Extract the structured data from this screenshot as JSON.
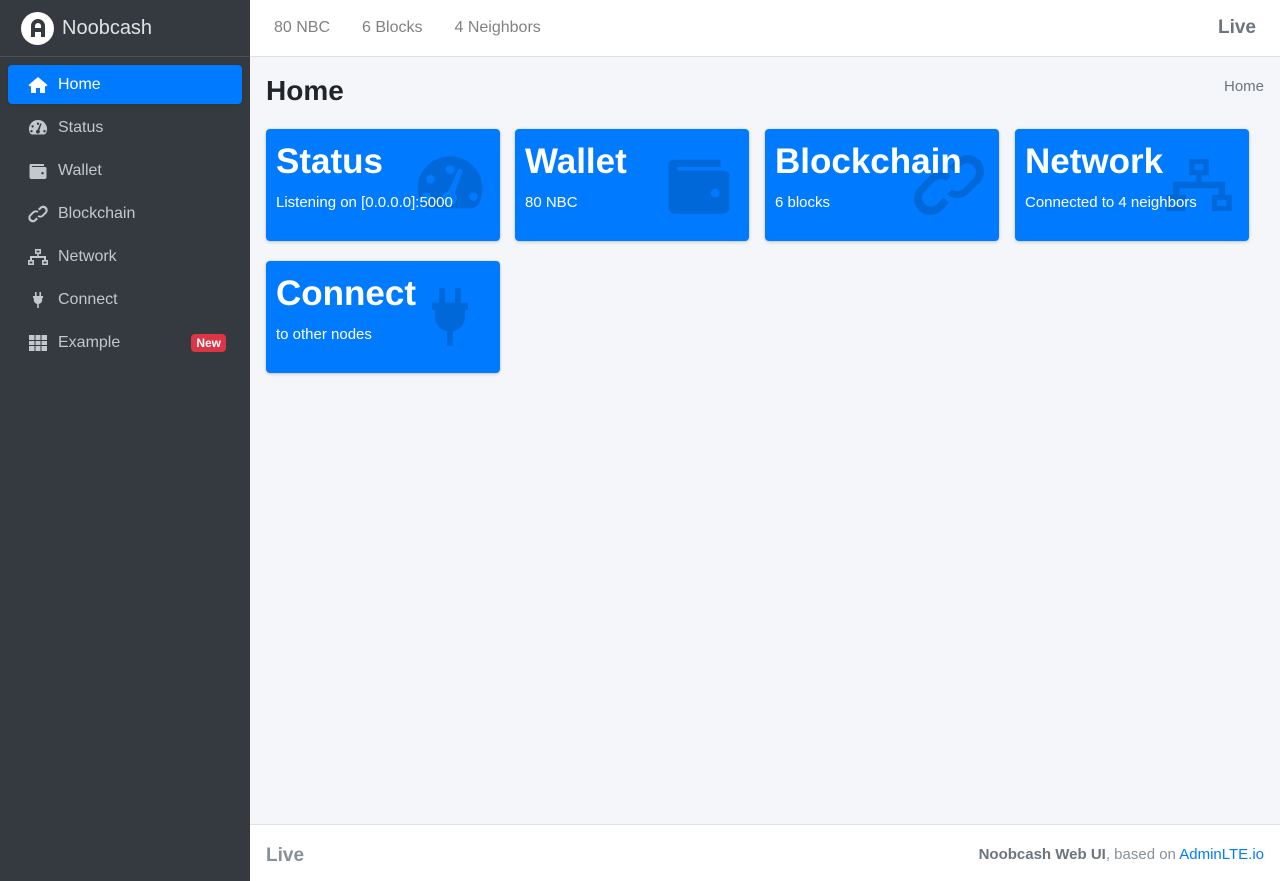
{
  "brand": {
    "name": "Noobcash",
    "logo_icon": "letter-a-circle-logo"
  },
  "sidebar": {
    "items": [
      {
        "label": "Home",
        "icon": "home-icon",
        "active": true
      },
      {
        "label": "Status",
        "icon": "gauge-icon"
      },
      {
        "label": "Wallet",
        "icon": "wallet-icon"
      },
      {
        "label": "Blockchain",
        "icon": "link-icon"
      },
      {
        "label": "Network",
        "icon": "network-icon"
      },
      {
        "label": "Connect",
        "icon": "plug-icon"
      },
      {
        "label": "Example",
        "icon": "grid-icon",
        "badge": "New"
      }
    ]
  },
  "topbar": {
    "balance": "80 NBC",
    "blocks": "6 Blocks",
    "neighbors": "4 Neighbors",
    "live": "Live"
  },
  "page": {
    "title": "Home",
    "breadcrumb": "Home"
  },
  "cards": [
    {
      "title": "Status",
      "text": "Listening on [0.0.0.0]:5000",
      "icon": "gauge-icon"
    },
    {
      "title": "Wallet",
      "text": "80 NBC",
      "icon": "wallet-icon"
    },
    {
      "title": "Blockchain",
      "text": "6 blocks",
      "icon": "link-icon"
    },
    {
      "title": "Network",
      "text": "Connected to 4 neighbors",
      "icon": "network-icon"
    },
    {
      "title": "Connect",
      "text": "to other nodes",
      "icon": "plug-icon"
    }
  ],
  "footer": {
    "live": "Live",
    "app_name": "Noobcash Web UI",
    "based_on": ", based on ",
    "link_text": "AdminLTE.io"
  },
  "colors": {
    "primary": "#007bff",
    "sidebar_bg": "#343a40",
    "badge": "#dc3545",
    "content_bg": "#f4f6f9"
  }
}
